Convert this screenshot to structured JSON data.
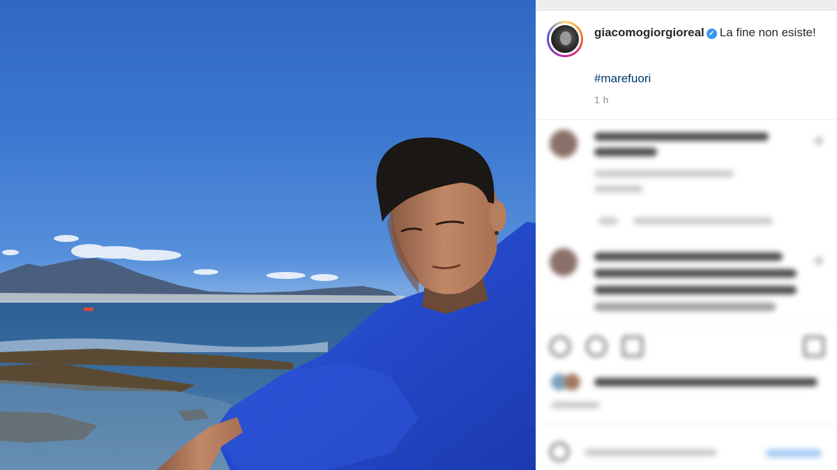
{
  "post": {
    "username": "giacomogiorgioreal",
    "verified_icon": "verified-badge-icon",
    "caption": "La fine non esiste!",
    "hashtag": "#marefuori",
    "timestamp": "1 h"
  },
  "photo": {
    "subject": "photo-of-man-in-blue-towel-by-the-sea"
  },
  "colors": {
    "username": "#262626",
    "hashtag": "#00376b",
    "timestamp": "#8e8e8e",
    "verified": "#3897f0"
  },
  "icons": [
    "heart-icon",
    "comment-icon",
    "share-icon",
    "bookmark-icon",
    "emoji-icon"
  ]
}
